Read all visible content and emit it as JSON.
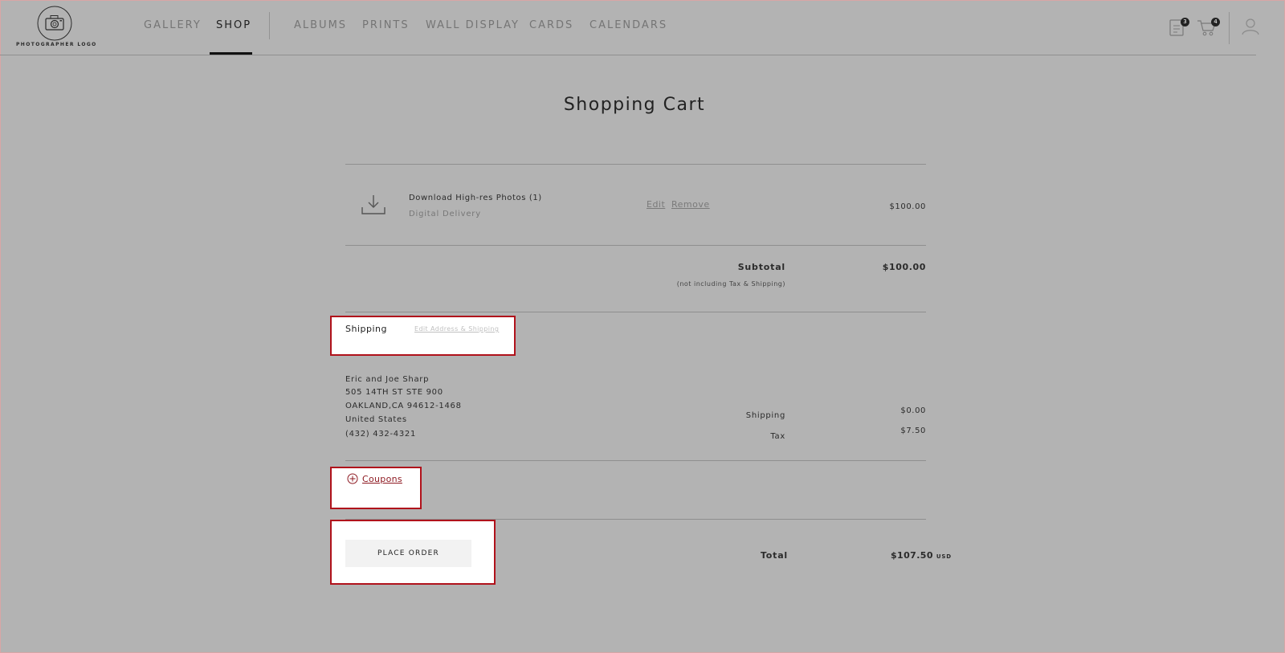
{
  "header": {
    "logo_text": "PHOTOGRAPHER LOGO",
    "nav": [
      {
        "label": "GALLERY",
        "active": false
      },
      {
        "label": "SHOP",
        "active": true
      },
      {
        "label": "ALBUMS",
        "active": false
      },
      {
        "label": "PRINTS",
        "active": false
      },
      {
        "label": "WALL DISPLAY",
        "active": false
      },
      {
        "label": "CARDS",
        "active": false
      },
      {
        "label": "CALENDARS",
        "active": false
      }
    ],
    "orders_badge": "3",
    "cart_badge": "4",
    "icons": [
      "orders-icon",
      "cart-icon",
      "account-icon"
    ]
  },
  "page_title": "Shopping Cart",
  "cart_item": {
    "name": "Download High-res Photos (1)",
    "delivery": "Digital Delivery",
    "edit_label": "Edit",
    "remove_label": "Remove",
    "price": "$100.00",
    "icon": "download-icon"
  },
  "subtotal": {
    "label": "Subtotal",
    "note": "(not including Tax & Shipping)",
    "value": "$100.00"
  },
  "shipping": {
    "title": "Shipping",
    "edit_label": "Edit Address & Shipping",
    "address": [
      "Eric and Joe Sharp",
      "505 14TH ST STE 900",
      "OAKLAND,CA 94612-1468",
      "United States",
      "(432) 432-4321"
    ]
  },
  "summary": {
    "shipping_label": "Shipping",
    "shipping_value": "$0.00",
    "tax_label": "Tax",
    "tax_value": "$7.50"
  },
  "coupons_label": "Coupons",
  "place_order_label": "PLACE ORDER",
  "total": {
    "label": "Total",
    "value": "$107.50",
    "currency": "USD"
  },
  "colors": {
    "background": "#b3b3b3",
    "highlight_border": "#b0121b",
    "coupon_link": "#8e1a22"
  }
}
